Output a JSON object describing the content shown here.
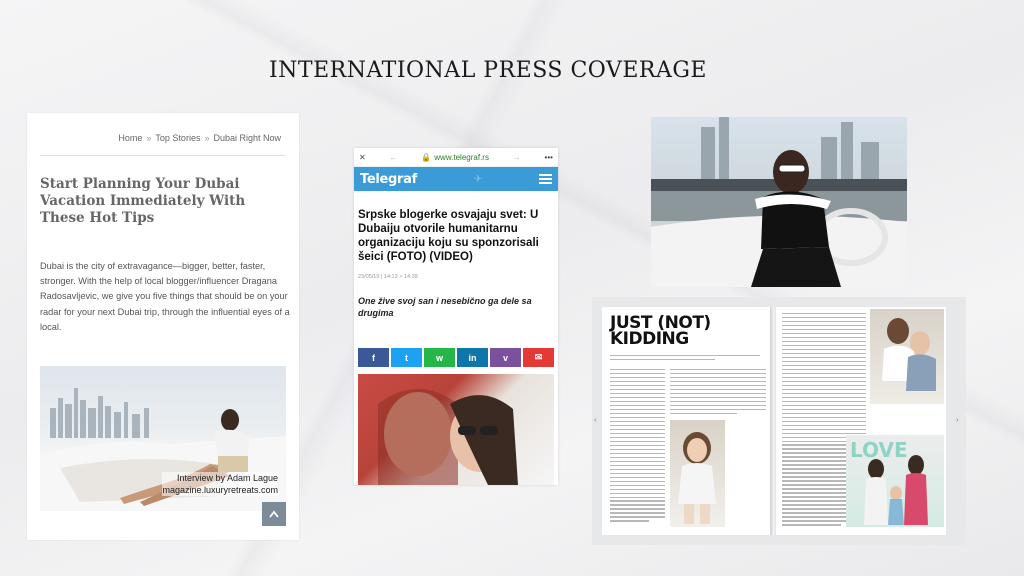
{
  "page": {
    "title": "INTERNATIONAL PRESS COVERAGE"
  },
  "article": {
    "breadcrumbs": [
      "Home",
      "Top Stories",
      "Dubai Right Now"
    ],
    "breadcrumb_sep": "»",
    "headline": "Start Planning Your Dubai Vacation Immediately With These Hot Tips",
    "body": "Dubai is the city of extravagance—bigger, better, faster, stronger. With the help of local blogger/influencer Dragana Radosavljevic, we give you five things that should be on your radar for your next Dubai trip, through the influential eyes of a local.",
    "credit_line1": "Interview by Adam Lague",
    "credit_line2": "magazine.luxuryretreats.com",
    "back_to_top_icon": "chevron-up-icon"
  },
  "telegraf": {
    "url": "www.telegraf.rs",
    "logo": "Telegraf",
    "headline": "Srpske blogerke osvajaju svet: U Dubaiju otvorile humanitarnu organizaciju koju su sponzorisali šeici (FOTO) (VIDEO)",
    "date": "23/05/19 | 14:13 > 14:39",
    "lead": "One žive svoj san i nesebično ga dele sa drugima",
    "share_buttons": [
      {
        "name": "facebook",
        "glyph": "f",
        "color": "#3b5998"
      },
      {
        "name": "twitter",
        "glyph": "t",
        "color": "#1da1f2"
      },
      {
        "name": "whatsapp",
        "glyph": "w",
        "color": "#25b64a"
      },
      {
        "name": "linkedin",
        "glyph": "in",
        "color": "#0e76a8"
      },
      {
        "name": "viber",
        "glyph": "v",
        "color": "#7b519d"
      },
      {
        "name": "email",
        "glyph": "✉",
        "color": "#e53935"
      }
    ]
  },
  "magazine": {
    "headline_line1": "JUST (NOT)",
    "headline_line2": "KIDDING"
  }
}
